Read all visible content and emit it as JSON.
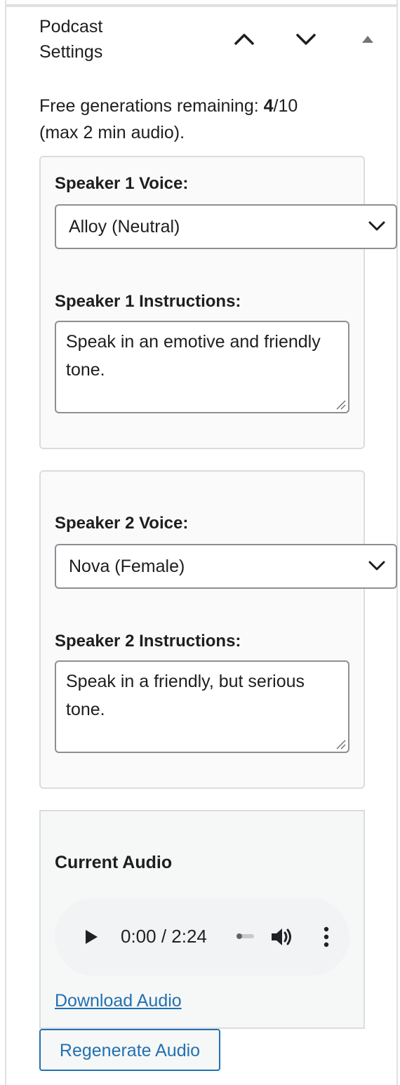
{
  "panel": {
    "title_line1": "Podcast",
    "title_line2": "Settings",
    "controls": [
      "chevron-up-icon",
      "chevron-down-icon",
      "triangle-up-icon"
    ]
  },
  "quota": {
    "prefix": "Free generations remaining: ",
    "used": "4",
    "total": "/10",
    "note": "(max 2 min audio)."
  },
  "speaker1": {
    "voice_label": "Speaker 1 Voice:",
    "voice_value": "Alloy (Neutral)",
    "instructions_label": "Speaker 1 Instructions:",
    "instructions_value": "Speak in an emotive and friendly tone."
  },
  "speaker2": {
    "voice_label": "Speaker 2 Voice:",
    "voice_value": "Nova (Female)",
    "instructions_label": "Speaker 2 Instructions:",
    "instructions_value": "Speak in a friendly, but serious tone."
  },
  "audio": {
    "title": "Current Audio",
    "time": "0:00 / 2:24",
    "progress": 0,
    "download_label": "Download Audio",
    "regenerate_label": "Regenerate Audio"
  },
  "colors": {
    "link": "#2271b1",
    "border": "#dcdcde",
    "text": "#1e1e1e"
  }
}
